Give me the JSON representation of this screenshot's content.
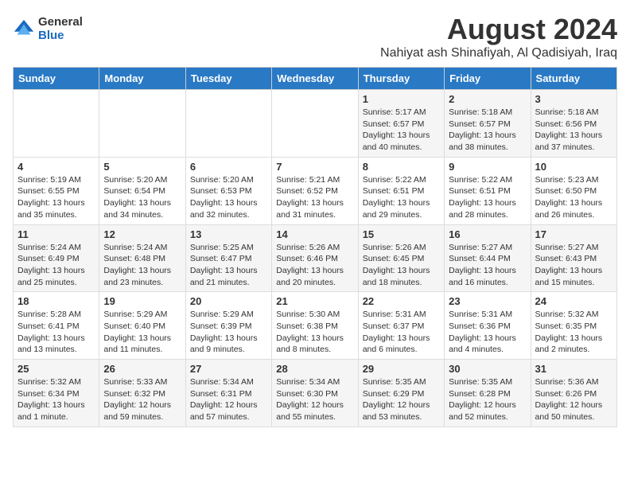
{
  "logo": {
    "general": "General",
    "blue": "Blue"
  },
  "title": "August 2024",
  "subtitle": "Nahiyat ash Shinafiyah, Al Qadisiyah, Iraq",
  "weekdays": [
    "Sunday",
    "Monday",
    "Tuesday",
    "Wednesday",
    "Thursday",
    "Friday",
    "Saturday"
  ],
  "weeks": [
    [
      {
        "day": "",
        "info": ""
      },
      {
        "day": "",
        "info": ""
      },
      {
        "day": "",
        "info": ""
      },
      {
        "day": "",
        "info": ""
      },
      {
        "day": "1",
        "info": "Sunrise: 5:17 AM\nSunset: 6:57 PM\nDaylight: 13 hours\nand 40 minutes."
      },
      {
        "day": "2",
        "info": "Sunrise: 5:18 AM\nSunset: 6:57 PM\nDaylight: 13 hours\nand 38 minutes."
      },
      {
        "day": "3",
        "info": "Sunrise: 5:18 AM\nSunset: 6:56 PM\nDaylight: 13 hours\nand 37 minutes."
      }
    ],
    [
      {
        "day": "4",
        "info": "Sunrise: 5:19 AM\nSunset: 6:55 PM\nDaylight: 13 hours\nand 35 minutes."
      },
      {
        "day": "5",
        "info": "Sunrise: 5:20 AM\nSunset: 6:54 PM\nDaylight: 13 hours\nand 34 minutes."
      },
      {
        "day": "6",
        "info": "Sunrise: 5:20 AM\nSunset: 6:53 PM\nDaylight: 13 hours\nand 32 minutes."
      },
      {
        "day": "7",
        "info": "Sunrise: 5:21 AM\nSunset: 6:52 PM\nDaylight: 13 hours\nand 31 minutes."
      },
      {
        "day": "8",
        "info": "Sunrise: 5:22 AM\nSunset: 6:51 PM\nDaylight: 13 hours\nand 29 minutes."
      },
      {
        "day": "9",
        "info": "Sunrise: 5:22 AM\nSunset: 6:51 PM\nDaylight: 13 hours\nand 28 minutes."
      },
      {
        "day": "10",
        "info": "Sunrise: 5:23 AM\nSunset: 6:50 PM\nDaylight: 13 hours\nand 26 minutes."
      }
    ],
    [
      {
        "day": "11",
        "info": "Sunrise: 5:24 AM\nSunset: 6:49 PM\nDaylight: 13 hours\nand 25 minutes."
      },
      {
        "day": "12",
        "info": "Sunrise: 5:24 AM\nSunset: 6:48 PM\nDaylight: 13 hours\nand 23 minutes."
      },
      {
        "day": "13",
        "info": "Sunrise: 5:25 AM\nSunset: 6:47 PM\nDaylight: 13 hours\nand 21 minutes."
      },
      {
        "day": "14",
        "info": "Sunrise: 5:26 AM\nSunset: 6:46 PM\nDaylight: 13 hours\nand 20 minutes."
      },
      {
        "day": "15",
        "info": "Sunrise: 5:26 AM\nSunset: 6:45 PM\nDaylight: 13 hours\nand 18 minutes."
      },
      {
        "day": "16",
        "info": "Sunrise: 5:27 AM\nSunset: 6:44 PM\nDaylight: 13 hours\nand 16 minutes."
      },
      {
        "day": "17",
        "info": "Sunrise: 5:27 AM\nSunset: 6:43 PM\nDaylight: 13 hours\nand 15 minutes."
      }
    ],
    [
      {
        "day": "18",
        "info": "Sunrise: 5:28 AM\nSunset: 6:41 PM\nDaylight: 13 hours\nand 13 minutes."
      },
      {
        "day": "19",
        "info": "Sunrise: 5:29 AM\nSunset: 6:40 PM\nDaylight: 13 hours\nand 11 minutes."
      },
      {
        "day": "20",
        "info": "Sunrise: 5:29 AM\nSunset: 6:39 PM\nDaylight: 13 hours\nand 9 minutes."
      },
      {
        "day": "21",
        "info": "Sunrise: 5:30 AM\nSunset: 6:38 PM\nDaylight: 13 hours\nand 8 minutes."
      },
      {
        "day": "22",
        "info": "Sunrise: 5:31 AM\nSunset: 6:37 PM\nDaylight: 13 hours\nand 6 minutes."
      },
      {
        "day": "23",
        "info": "Sunrise: 5:31 AM\nSunset: 6:36 PM\nDaylight: 13 hours\nand 4 minutes."
      },
      {
        "day": "24",
        "info": "Sunrise: 5:32 AM\nSunset: 6:35 PM\nDaylight: 13 hours\nand 2 minutes."
      }
    ],
    [
      {
        "day": "25",
        "info": "Sunrise: 5:32 AM\nSunset: 6:34 PM\nDaylight: 13 hours\nand 1 minute."
      },
      {
        "day": "26",
        "info": "Sunrise: 5:33 AM\nSunset: 6:32 PM\nDaylight: 12 hours\nand 59 minutes."
      },
      {
        "day": "27",
        "info": "Sunrise: 5:34 AM\nSunset: 6:31 PM\nDaylight: 12 hours\nand 57 minutes."
      },
      {
        "day": "28",
        "info": "Sunrise: 5:34 AM\nSunset: 6:30 PM\nDaylight: 12 hours\nand 55 minutes."
      },
      {
        "day": "29",
        "info": "Sunrise: 5:35 AM\nSunset: 6:29 PM\nDaylight: 12 hours\nand 53 minutes."
      },
      {
        "day": "30",
        "info": "Sunrise: 5:35 AM\nSunset: 6:28 PM\nDaylight: 12 hours\nand 52 minutes."
      },
      {
        "day": "31",
        "info": "Sunrise: 5:36 AM\nSunset: 6:26 PM\nDaylight: 12 hours\nand 50 minutes."
      }
    ]
  ]
}
